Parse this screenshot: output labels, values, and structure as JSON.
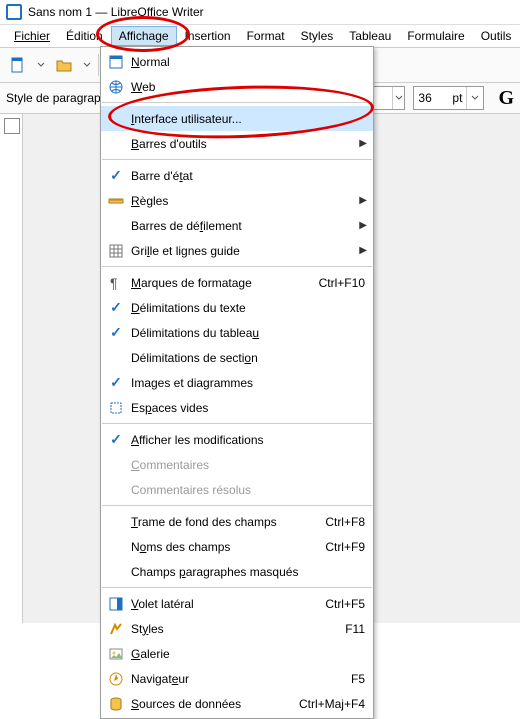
{
  "title": "Sans nom 1 — LibreOffice Writer",
  "menubar": {
    "fichier": "Fichier",
    "edition": "Édition",
    "affichage": "Affichage",
    "insertion": "Insertion",
    "format": "Format",
    "styles": "Styles",
    "tableau": "Tableau",
    "formulaire": "Formulaire",
    "outils": "Outils"
  },
  "secondbar": {
    "style_label": "Style de paragraph",
    "font_size": "36",
    "pt": "pt",
    "g": "G"
  },
  "menu": {
    "normal": "Normal",
    "web": "Web",
    "interface": "Interface utilisateur...",
    "barres_outils": "Barres d'outils",
    "barre_etat": "Barre d'état",
    "regles": "Règles",
    "barres_defilement": "Barres de défilement",
    "grille": "Grille et lignes guide",
    "marques_formatage": "Marques de formatage",
    "sc_marques": "Ctrl+F10",
    "delim_texte": "Délimitations du texte",
    "delim_tableau": "Délimitations du tableau",
    "delim_section": "Délimitations de section",
    "images_diag": "Images et diagrammes",
    "espaces_vides": "Espaces vides",
    "afficher_modif": "Afficher les modifications",
    "commentaires": "Commentaires",
    "commentaires_res": "Commentaires résolus",
    "trame_fond": "Trame de fond des champs",
    "sc_trame": "Ctrl+F8",
    "noms_champs": "Noms des champs",
    "sc_noms": "Ctrl+F9",
    "champs_masques": "Champs paragraphes masqués",
    "volet_lateral": "Volet latéral",
    "sc_volet": "Ctrl+F5",
    "styles": "Styles",
    "sc_styles": "F11",
    "galerie": "Galerie",
    "navigateur": "Navigateur",
    "sc_nav": "F5",
    "sources_donnees": "Sources de données",
    "sc_sources": "Ctrl+Maj+F4"
  }
}
